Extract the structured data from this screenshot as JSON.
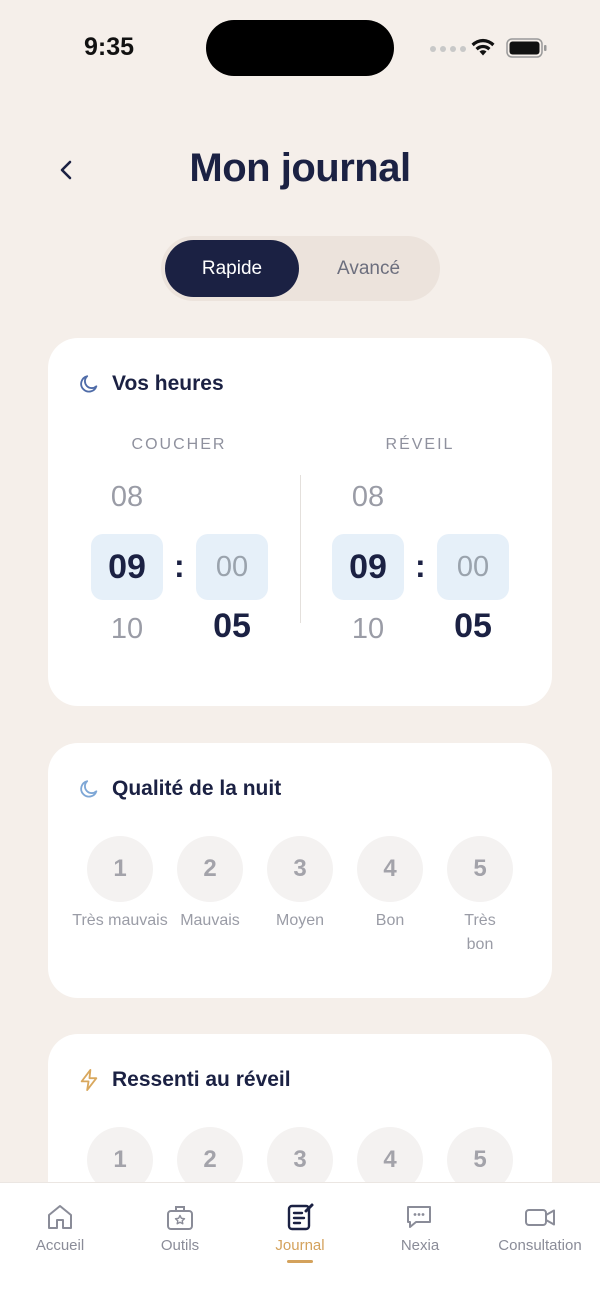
{
  "status_bar": {
    "time": "9:35"
  },
  "header": {
    "title": "Mon journal"
  },
  "mode_toggle": {
    "options": [
      "Rapide",
      "Avancé"
    ],
    "selected": "Rapide"
  },
  "hours_card": {
    "title": "Vos heures",
    "bedtime": {
      "label": "COUCHER",
      "hour_prev": "08",
      "hour": "09",
      "hour_next": "10",
      "minute": "00",
      "minute_next": "05"
    },
    "wake": {
      "label": "RÉVEIL",
      "hour_prev": "08",
      "hour": "09",
      "hour_next": "10",
      "minute": "00",
      "minute_next": "05"
    }
  },
  "night_quality": {
    "title": "Qualité de la nuit",
    "options": [
      {
        "value": "1",
        "label": "Très mauvais"
      },
      {
        "value": "2",
        "label": "Mauvais"
      },
      {
        "value": "3",
        "label": "Moyen"
      },
      {
        "value": "4",
        "label": "Bon"
      },
      {
        "value": "5",
        "label": "Très bon"
      }
    ]
  },
  "wake_feeling": {
    "title": "Ressenti au réveil",
    "options": [
      {
        "value": "1"
      },
      {
        "value": "2"
      },
      {
        "value": "3"
      },
      {
        "value": "4"
      },
      {
        "value": "5"
      }
    ]
  },
  "tabbar": {
    "items": [
      {
        "label": "Accueil",
        "icon": "home-icon"
      },
      {
        "label": "Outils",
        "icon": "toolbox-icon"
      },
      {
        "label": "Journal",
        "icon": "journal-icon"
      },
      {
        "label": "Nexia",
        "icon": "chat-icon"
      },
      {
        "label": "Consultation",
        "icon": "video-icon"
      }
    ],
    "active": "Journal"
  },
  "colors": {
    "navy": "#1b2143",
    "background": "#f5efea",
    "accent": "#d4a25c",
    "highlight": "#e6f0f9"
  }
}
